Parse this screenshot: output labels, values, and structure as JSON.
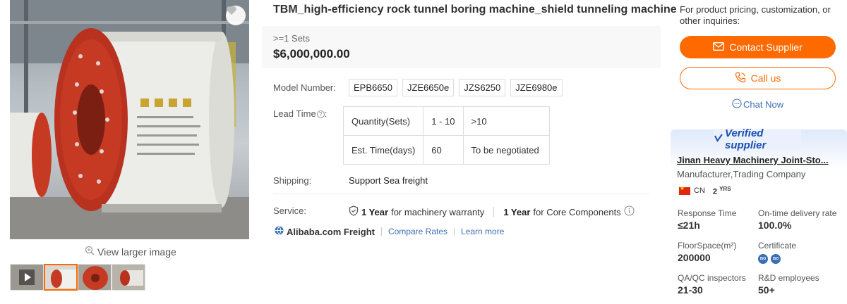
{
  "product": {
    "title": "TBM_high-efficiency rock tunnel boring machine_shield tunneling machine",
    "price_qty": ">=1 Sets",
    "price": "$6,000,000.00"
  },
  "gallery": {
    "view_larger": "View larger image",
    "thumbnail_count": 4
  },
  "model_number": {
    "label": "Model Number:",
    "values": [
      "EPB6650",
      "JZE6650e",
      "JZS6250",
      "JZE6980e"
    ]
  },
  "lead_time": {
    "label": "Lead Time",
    "rows": [
      [
        "Quantity(Sets)",
        "1 - 10",
        ">10"
      ],
      [
        "Est. Time(days)",
        "60",
        "To be negotiated"
      ]
    ]
  },
  "shipping": {
    "label": "Shipping:",
    "value": "Support Sea freight"
  },
  "service": {
    "label": "Service:",
    "warranty_years": "1 Year",
    "warranty_text": "for machinery warranty",
    "core_years": "1 Year",
    "core_text": "for Core Components"
  },
  "freight": {
    "brand": "Alibaba.com Freight",
    "compare": "Compare Rates",
    "learn": "Learn more"
  },
  "contact": {
    "inquiry_text": "For product pricing, customization, or other inquiries:",
    "contact_btn": "Contact Supplier",
    "call_btn": "Call us",
    "chat_link": "Chat Now"
  },
  "supplier": {
    "badge": "Verified supplier",
    "name": "Jinan Heavy Machinery Joint-Sto...",
    "type": "Manufacturer,Trading Company",
    "country": "CN",
    "years": "2",
    "years_unit": "YRS",
    "stats": {
      "response_time_label": "Response Time",
      "response_time": "≤21h",
      "ontime_label": "On-time delivery rate",
      "ontime": "100.0%",
      "floorspace_label": "FloorSpace(m²)",
      "floorspace": "200000",
      "certificate_label": "Certificate",
      "qa_label": "QA/QC inspectors",
      "qa": "21-30",
      "rd_label": "R&D employees",
      "rd": "50+"
    }
  },
  "colors": {
    "accent": "#ff6a00",
    "link": "#3b6fb6",
    "verified": "#1d4db3"
  }
}
